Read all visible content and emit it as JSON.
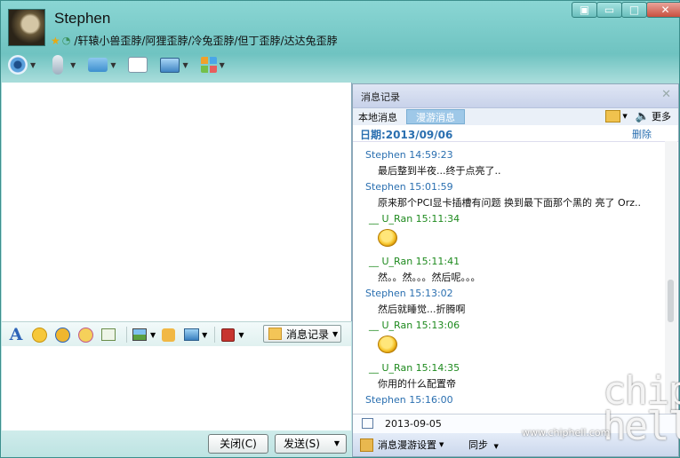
{
  "user": {
    "name": "Stephen",
    "signature": "/轩辕小兽歪脖/阿狸歪脖/冷兔歪脖/但丁歪脖/达达兔歪脖"
  },
  "window_controls": [
    "▣",
    "▭",
    "□",
    "✕"
  ],
  "format_toolbar": {
    "history_button": "消息记录"
  },
  "buttons": {
    "close": "关闭(C)",
    "send": "发送(S)"
  },
  "history": {
    "title": "消息记录",
    "tab_local": "本地消息",
    "tab_roaming": "漫游消息",
    "more": "更多",
    "date_header": "日期:2013/09/06",
    "delete": "删除",
    "messages": [
      {
        "sender": "Stephen 14:59:23",
        "text": "最后整到半夜...终于点亮了.."
      },
      {
        "sender": "Stephen 15:01:59",
        "text": "原来那个PCI显卡插槽有问题 换到最下面那个黑的 亮了 Orz.."
      },
      {
        "sender": "__    U_Ran 15:11:34",
        "text": ""
      },
      {
        "sender": "__    U_Ran 15:11:41",
        "text": "然。。然。。。然后呢。。。"
      },
      {
        "sender": "Stephen 15:13:02",
        "text": "然后就睡觉...折腾啊"
      },
      {
        "sender": "__    U_Ran 15:13:06",
        "text": ""
      },
      {
        "sender": "__    U_Ran 15:14:35",
        "text": "你用的什么配置帝"
      },
      {
        "sender": "Stephen 15:16:00",
        "text": ""
      }
    ],
    "date_picker_value": "2013-09-05",
    "footer_settings": "消息漫游设置",
    "footer_sync": "同步"
  },
  "watermark": {
    "logo": "chip hell",
    "url": "www.chiphell.com"
  }
}
